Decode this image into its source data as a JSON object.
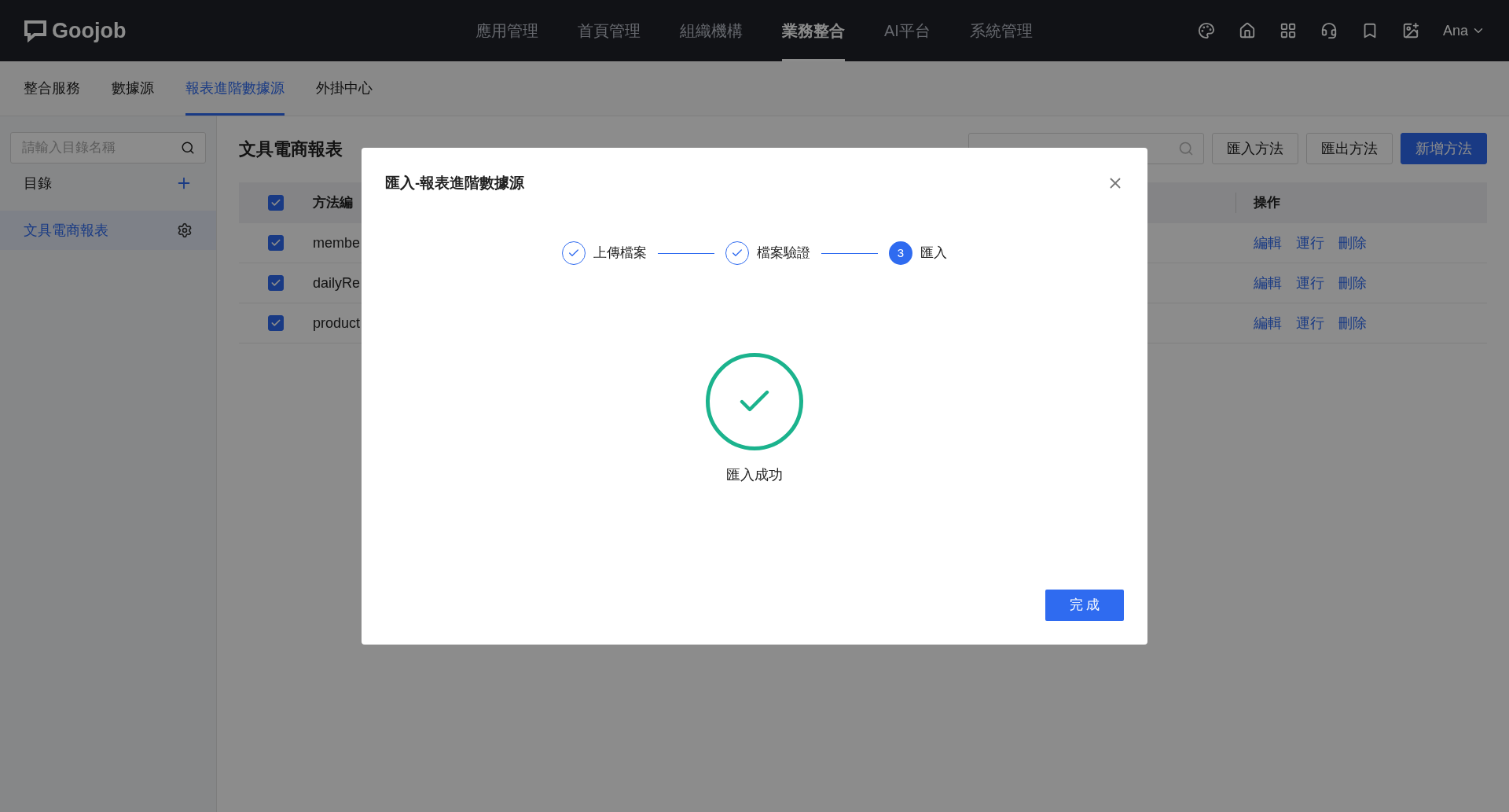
{
  "header": {
    "logo": "Goojob",
    "nav": [
      {
        "label": "應用管理",
        "selected": false
      },
      {
        "label": "首頁管理",
        "selected": false
      },
      {
        "label": "組織機構",
        "selected": false
      },
      {
        "label": "業務整合",
        "selected": true
      },
      {
        "label": "AI平台",
        "selected": false
      },
      {
        "label": "系統管理",
        "selected": false
      }
    ],
    "user": "Ana"
  },
  "subnav": [
    {
      "label": "整合服務",
      "selected": false
    },
    {
      "label": "數據源",
      "selected": false
    },
    {
      "label": "報表進階數據源",
      "selected": true
    },
    {
      "label": "外掛中心",
      "selected": false
    }
  ],
  "sidebar": {
    "search_placeholder": "請輸入目錄名稱",
    "heading": "目錄",
    "items": [
      {
        "label": "文具電商報表",
        "selected": true
      }
    ]
  },
  "main": {
    "title": "文具電商報表",
    "buttons": [
      {
        "label": "匯入方法",
        "kind": "default"
      },
      {
        "label": "匯出方法",
        "kind": "default"
      },
      {
        "label": "新增方法",
        "kind": "primary"
      }
    ],
    "table": {
      "header_checked": true,
      "columns": [
        "方法編",
        "操作"
      ],
      "rows": [
        {
          "checked": true,
          "column_1": "membe",
          "actions": [
            "編輯",
            "運行",
            "刪除"
          ]
        },
        {
          "checked": true,
          "column_1": "dailyRe",
          "actions": [
            "編輯",
            "運行",
            "刪除"
          ]
        },
        {
          "checked": true,
          "column_1": "product",
          "actions": [
            "編輯",
            "運行",
            "刪除"
          ]
        }
      ]
    }
  },
  "dialog": {
    "title": "匯入-報表進階數據源",
    "steps": [
      {
        "label": "上傳檔案",
        "kind": "done"
      },
      {
        "label": "檔案驗證",
        "kind": "done"
      },
      {
        "label": "匯入",
        "kind": "current",
        "number": "3"
      }
    ],
    "result": "匯入成功",
    "button": "完 成"
  }
}
